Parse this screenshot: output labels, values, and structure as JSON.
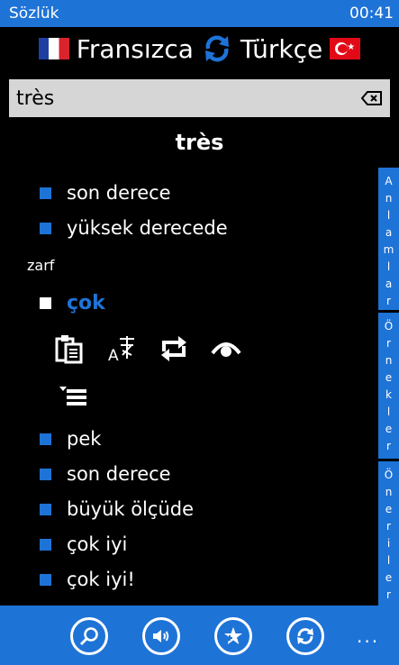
{
  "status_bar": {
    "app_name": "Sözlük",
    "time": "00:41"
  },
  "language_bar": {
    "source_language": "Fransızca",
    "target_language": "Türkçe",
    "source_flag": "france-flag",
    "target_flag": "turkey-flag"
  },
  "search": {
    "value": "très",
    "placeholder": ""
  },
  "headword": "très",
  "translations_group_1": [
    "son derece",
    "yüksek derecede"
  ],
  "part_of_speech": "zarf",
  "selected_translation": "çok",
  "action_icons": [
    "clipboard-icon",
    "translate-icon",
    "repeat-icon",
    "eye-icon",
    "menu-list-icon"
  ],
  "translations_group_2": [
    "pek",
    "son derece",
    "büyük ölçüde",
    "çok iyi",
    "çok iyi!"
  ],
  "side_tabs": [
    {
      "label": "Anlamlar",
      "letters": [
        "A",
        "n",
        "l",
        "a",
        "m",
        "l",
        "a",
        "r"
      ]
    },
    {
      "label": "Örnekler",
      "letters": [
        "Ö",
        "r",
        "n",
        "e",
        "k",
        "l",
        "e",
        "r"
      ]
    },
    {
      "label": "Öneriler",
      "letters": [
        "Ö",
        "n",
        "e",
        "r",
        "i",
        "l",
        "e",
        "r"
      ]
    }
  ],
  "bottom_bar": {
    "buttons": [
      "search-icon",
      "speaker-icon",
      "favorite-add-icon",
      "sync-icon"
    ],
    "more_label": "..."
  },
  "colors": {
    "accent": "#1e73d7",
    "background": "#000000",
    "search_bg": "#d6d6d6"
  }
}
